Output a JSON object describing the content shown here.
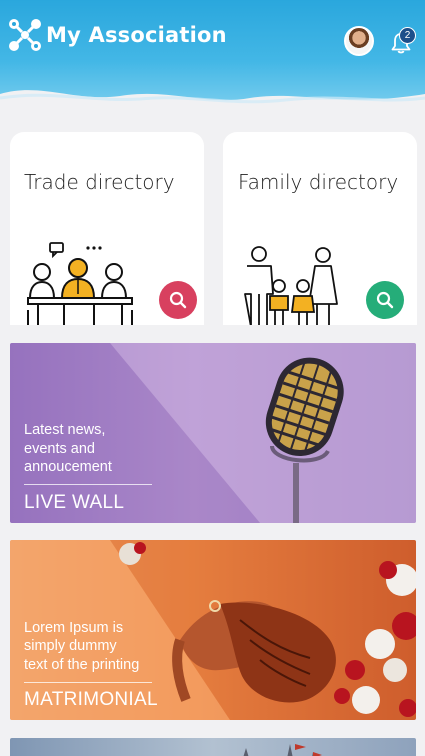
{
  "app": {
    "title": "My Association",
    "notification_count": "2",
    "colors": {
      "header": "#2aa7dd",
      "trade_accent": "#d8405f",
      "family_accent": "#25ad79"
    }
  },
  "cards": {
    "trade": {
      "title": "Trade directory",
      "icon": "search-icon"
    },
    "family": {
      "title": "Family directory",
      "icon": "search-icon"
    }
  },
  "banners": {
    "live_wall": {
      "line1": "Latest news,",
      "line2": "events and",
      "line3": "annoucement",
      "title": "LIVE WALL"
    },
    "matrimonial": {
      "line1": "Lorem Ipsum is",
      "line2": "simply dummy",
      "line3": "text of the printing",
      "title": "MATRIMONIAL"
    }
  }
}
